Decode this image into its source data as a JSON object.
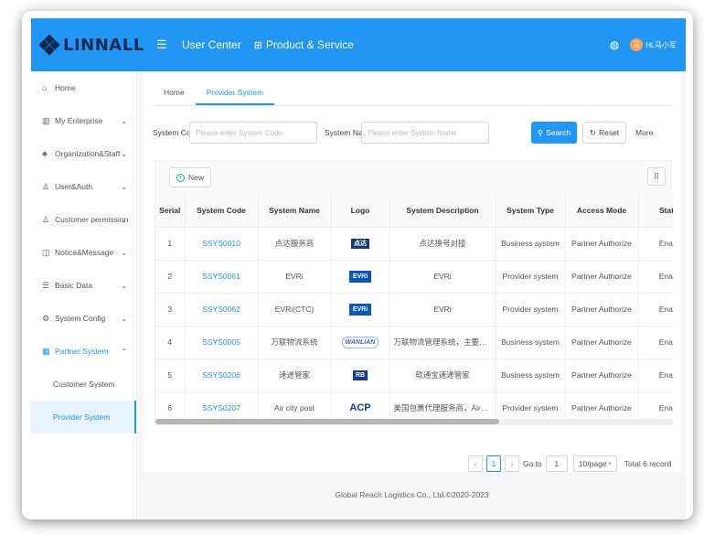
{
  "header": {
    "logo_text": "LINNALL",
    "nav": [
      {
        "icon": "menu-icon",
        "label": "User Center"
      },
      {
        "icon": "grid-icon",
        "label": "Product & Service"
      }
    ],
    "avatar_text": "马",
    "username": "Hi,马小军"
  },
  "sidebar": {
    "items": [
      {
        "icon": "home-icon",
        "label": "Home"
      },
      {
        "icon": "building-icon",
        "label": "My Enterprise"
      },
      {
        "icon": "org-icon",
        "label": "Organization&Staff"
      },
      {
        "icon": "user-auth-icon",
        "label": "User&Auth"
      },
      {
        "icon": "permission-icon",
        "label": "Customer permission"
      },
      {
        "icon": "bell-icon",
        "label": "Notice&Message"
      },
      {
        "icon": "database-icon",
        "label": "Basic Data"
      },
      {
        "icon": "gear-icon",
        "label": "System Config"
      },
      {
        "icon": "partner-icon",
        "label": "Partner System"
      }
    ],
    "sub_items": [
      "Customer System",
      "Provider System"
    ]
  },
  "tabs": [
    "Home",
    "Provider System"
  ],
  "filter": {
    "code_label": "System Code",
    "code_placeholder": "Please enter System Code",
    "name_label": "System Name",
    "name_placeholder": "Please enter System Name",
    "search_label": "Search",
    "reset_label": "Reset",
    "more_label": "More"
  },
  "toolbar": {
    "new_label": "New"
  },
  "table": {
    "headers": [
      "Serial",
      "System Code",
      "System Name",
      "Logo",
      "System Description",
      "System Type",
      "Access Mode",
      "Status"
    ],
    "rows": [
      {
        "serial": "1",
        "code": "SSYS0010",
        "name": "点达服务商",
        "logo": "点达",
        "desc": "点达换号对接",
        "type": "Business system",
        "access": "Partner Authorize",
        "status": "Enable"
      },
      {
        "serial": "2",
        "code": "SSYS0061",
        "name": "EVRi",
        "logo": "EVRi",
        "desc": "EVRi",
        "type": "Provider system",
        "access": "Partner Authorize",
        "status": "Enable"
      },
      {
        "serial": "3",
        "code": "SSYS0062",
        "name": "EVRi(CTC)",
        "logo": "EVRi",
        "desc": "EVRi",
        "type": "Provider system",
        "access": "Partner Authorize",
        "status": "Enable"
      },
      {
        "serial": "4",
        "code": "SSYS0005",
        "name": "万联物流系统",
        "logo": "WANLIAN",
        "desc": "万联物流管理系统，主要有仓...",
        "type": "Business system",
        "access": "Partner Authorize",
        "status": "Enable"
      },
      {
        "serial": "5",
        "code": "SSYS0206",
        "name": "速递管家",
        "logo": "RB",
        "desc": "软通宝速递管家",
        "type": "Business system",
        "access": "Partner Authorize",
        "status": "Enable"
      },
      {
        "serial": "6",
        "code": "SSYS0207",
        "name": "Air city post",
        "logo": "ACP",
        "desc": "美国包裹代理服务商，AirCity...",
        "type": "Provider system",
        "access": "Partner Authorize",
        "status": "Enable"
      }
    ]
  },
  "pagination": {
    "prev": "‹",
    "current_page": "1",
    "next": "›",
    "goto_label": "Go to",
    "goto_value": "1",
    "page_size": "10/page",
    "total": "Total 6 record"
  },
  "footer": "Global Reach Logistics Co., Ltd.©2020-2023",
  "colors": {
    "primary": "#2196f3",
    "logo_dark": "#0d2a55"
  }
}
